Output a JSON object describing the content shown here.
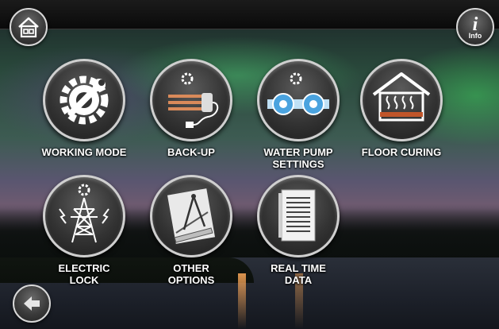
{
  "header": {
    "home_icon": "home-icon",
    "info_icon": "info-icon",
    "info_label": "Info"
  },
  "footer": {
    "back_icon": "left-arrow-icon"
  },
  "menu": {
    "items": [
      {
        "label": "WORKING MODE",
        "icon": "gear-wrench-icon"
      },
      {
        "label": "BACK-UP",
        "icon": "heater-plug-icon"
      },
      {
        "label": "WATER PUMP\nSETTINGS",
        "icon": "water-pump-icon"
      },
      {
        "label": "FLOOR CURING",
        "icon": "floor-heating-house-icon"
      },
      {
        "label": "ELECTRIC\nLOCK",
        "icon": "power-tower-icon"
      },
      {
        "label": "OTHER\nOPTIONS",
        "icon": "drafting-tools-icon"
      },
      {
        "label": "REAL TIME\nDATA",
        "icon": "data-sheet-icon"
      }
    ]
  },
  "colors": {
    "label_text": "#ffffff",
    "button_ring": "#cfcfcf",
    "pump_blue": "#4aa3df"
  }
}
